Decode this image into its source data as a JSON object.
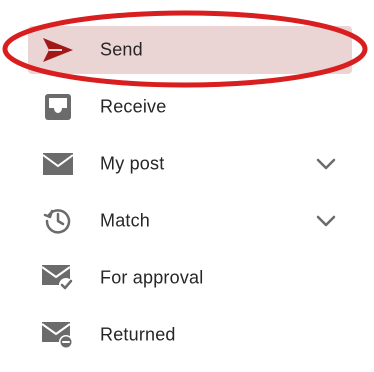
{
  "nav": {
    "items": [
      {
        "label": "Send",
        "icon": "send-icon",
        "active": true,
        "expandable": false
      },
      {
        "label": "Receive",
        "icon": "inbox-icon",
        "active": false,
        "expandable": false
      },
      {
        "label": "My post",
        "icon": "mail-icon",
        "active": false,
        "expandable": true
      },
      {
        "label": "Match",
        "icon": "clock-history-icon",
        "active": false,
        "expandable": true
      },
      {
        "label": "For approval",
        "icon": "mail-check-icon",
        "active": false,
        "expandable": false
      },
      {
        "label": "Returned",
        "icon": "mail-minus-icon",
        "active": false,
        "expandable": false
      }
    ]
  },
  "colors": {
    "accent": "#a01818",
    "active_background": "#ebd4d4",
    "icon": "#6b6b6b",
    "annotation_ring": "#d81e1e"
  }
}
